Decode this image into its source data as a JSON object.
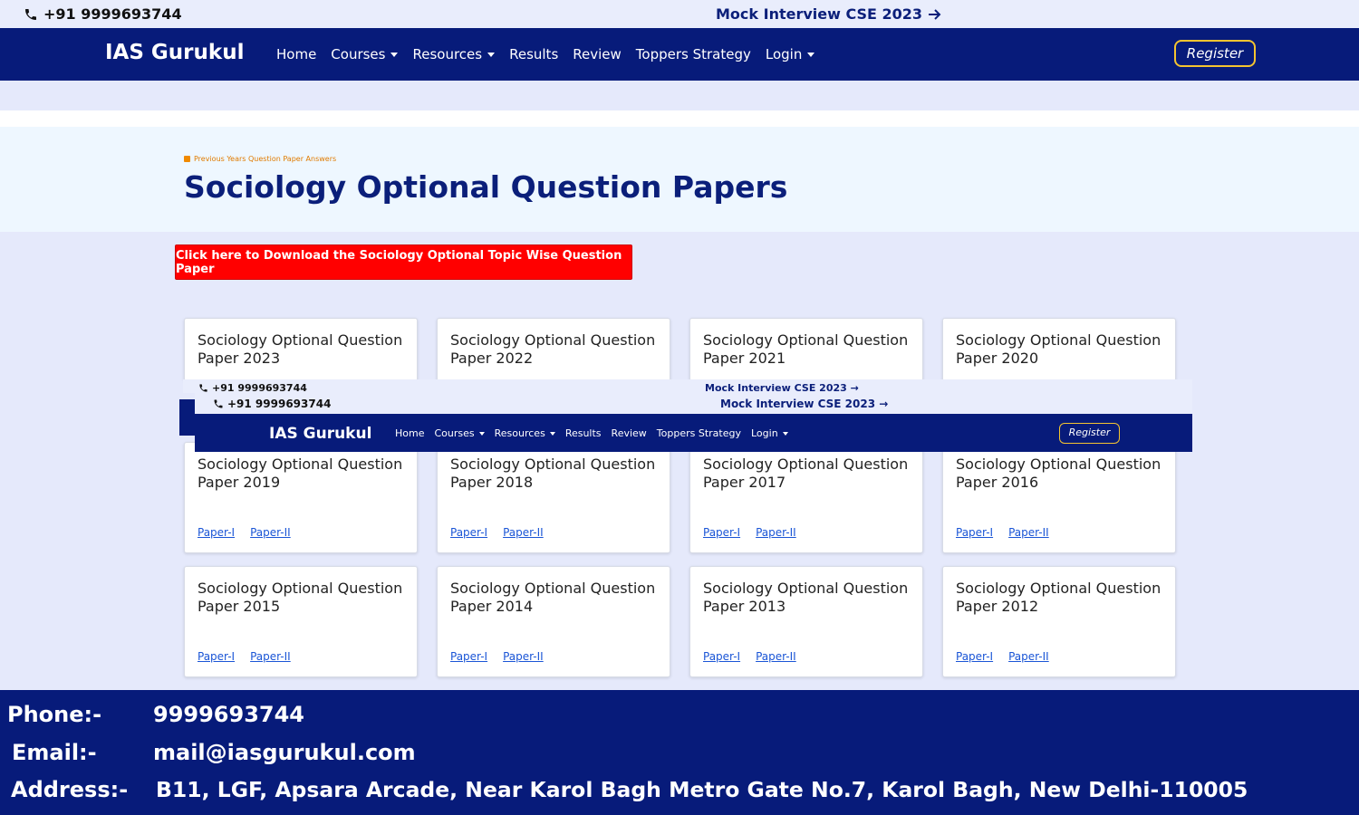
{
  "topbar": {
    "phone": "+91 9999693744",
    "mock_link": "Mock Interview CSE 2023"
  },
  "navbar": {
    "brand": "IAS Gurukul",
    "items": [
      "Home",
      "Courses",
      "Resources",
      "Results",
      "Review",
      "Toppers Strategy",
      "Login"
    ],
    "register": "Register"
  },
  "hero": {
    "breadcrumb": "Previous Years Question Paper Answers",
    "title": "Sociology Optional Question Papers"
  },
  "download_button": "Click here to Download the Sociology Optional Topic Wise Question Paper",
  "cards": [
    {
      "title": "Sociology Optional Question Paper 2023"
    },
    {
      "title": "Sociology Optional Question Paper 2022"
    },
    {
      "title": "Sociology Optional Question Paper 2021"
    },
    {
      "title": "Sociology Optional Question Paper 2020"
    },
    {
      "title": "Sociology Optional Question Paper 2019",
      "links": [
        "Paper-I",
        "Paper-II"
      ]
    },
    {
      "title": "Sociology Optional Question Paper 2018",
      "links": [
        "Paper-I",
        "Paper-II"
      ]
    },
    {
      "title": "Sociology Optional Question Paper 2017",
      "links": [
        "Paper-I",
        "Paper-II"
      ]
    },
    {
      "title": "Sociology Optional Question Paper 2016",
      "links": [
        "Paper-I",
        "Paper-II"
      ]
    },
    {
      "title": "Sociology Optional Question Paper 2015",
      "links": [
        "Paper-I",
        "Paper-II"
      ]
    },
    {
      "title": "Sociology Optional Question Paper 2014",
      "links": [
        "Paper-I",
        "Paper-II"
      ]
    },
    {
      "title": "Sociology Optional Question Paper 2013",
      "links": [
        "Paper-I",
        "Paper-II"
      ]
    },
    {
      "title": "Sociology Optional Question Paper 2012",
      "links": [
        "Paper-I",
        "Paper-II"
      ]
    }
  ],
  "overlay_header": {
    "phone_a": "+91 9999693744",
    "mock_a": "Mock Interview CSE 2023",
    "phone_b": "+91 9999693744",
    "mock_b": "Mock Interview CSE 2023",
    "brand": "IAS Gurukul",
    "items": [
      "Home",
      "Courses",
      "Resources",
      "Results",
      "Review",
      "Toppers Strategy",
      "Login"
    ],
    "register": "Register"
  },
  "footer": {
    "phone_label": "Phone:-",
    "phone_value": "9999693744",
    "email_label": "Email:-",
    "email_value": "mail@iasgurukul.com",
    "address_label": "Address:-",
    "address_value": "B11, LGF, Apsara Arcade, Near Karol Bagh Metro Gate No.7, Karol Bagh, New Delhi-110005"
  },
  "colors": {
    "navy": "#071b7a",
    "accent_red": "#ff0000",
    "register_border": "#f4c430",
    "link_blue": "#1a55d6"
  }
}
